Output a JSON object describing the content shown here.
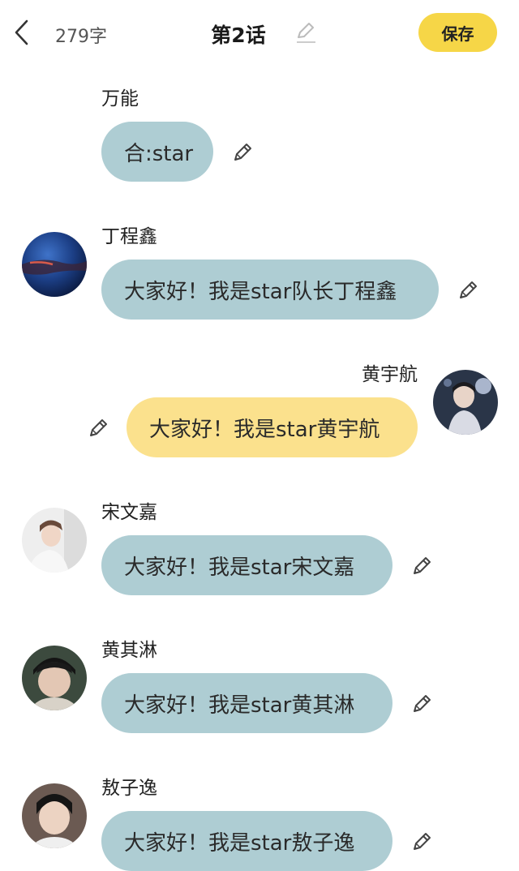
{
  "header": {
    "back_icon": "chevron-left-icon",
    "word_count": "279字",
    "title": "第2话",
    "title_edit_icon": "pencil-icon",
    "save_label": "保存",
    "save_color": "#f6d647"
  },
  "colors": {
    "bubble_other": "#aecdd3",
    "bubble_self": "#fbe18d",
    "background": "#ffffff"
  },
  "messages": [
    {
      "speaker": "万能",
      "text": "合:star",
      "side": "left",
      "avatar": false
    },
    {
      "speaker": "丁程鑫",
      "text": "大家好！我是star队长丁程鑫",
      "side": "left",
      "avatar": true
    },
    {
      "speaker": "黄宇航",
      "text": "大家好！我是star黄宇航",
      "side": "right",
      "avatar": true
    },
    {
      "speaker": "宋文嘉",
      "text": "大家好！我是star宋文嘉",
      "side": "left",
      "avatar": true
    },
    {
      "speaker": "黄其淋",
      "text": "大家好！我是star黄其淋",
      "side": "left",
      "avatar": true
    },
    {
      "speaker": "敖子逸",
      "text": "大家好！我是star敖子逸",
      "side": "left",
      "avatar": true
    }
  ]
}
